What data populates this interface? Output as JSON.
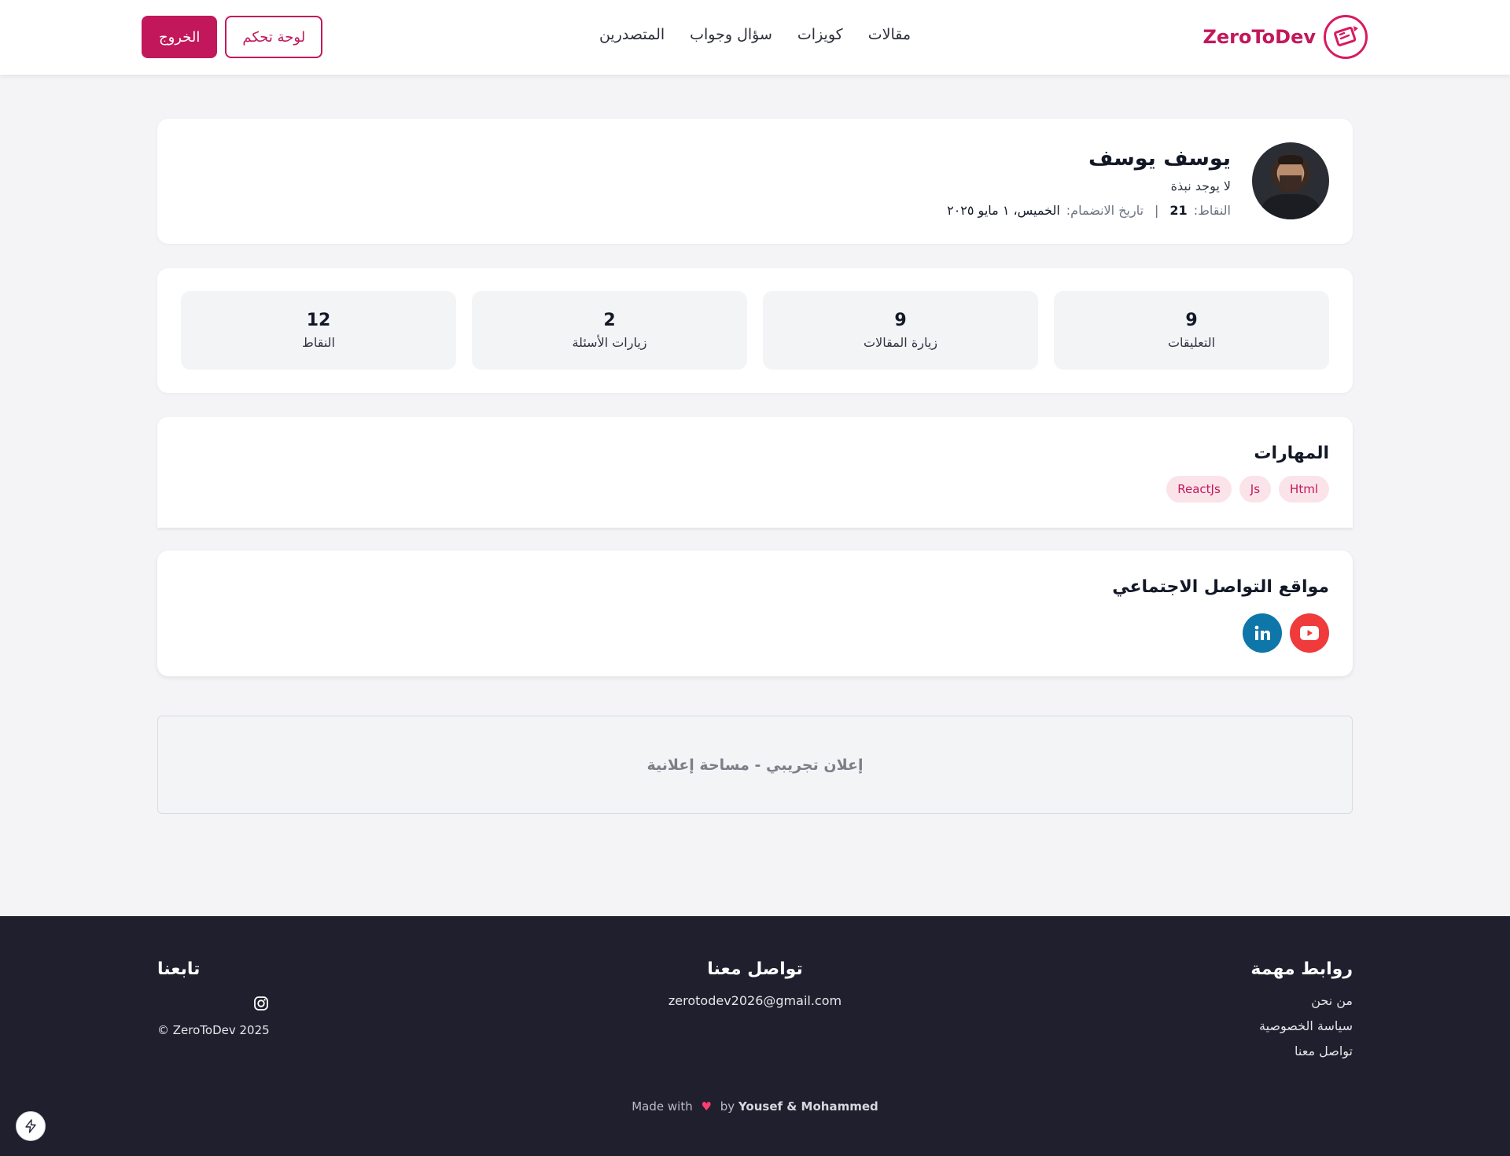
{
  "header": {
    "logo_text": "ZeroToDev",
    "nav": [
      {
        "label": "مقالات"
      },
      {
        "label": "كويزات"
      },
      {
        "label": "سؤال وجواب"
      },
      {
        "label": "المتصدرين"
      }
    ],
    "dashboard_label": "لوحة تحكم",
    "logout_label": "الخروج",
    "brand_color": "#c2185b"
  },
  "profile": {
    "name": "يوسف يوسف",
    "bio": "لا يوجد نبذة",
    "points_label": "النقاط:",
    "points_value": "21",
    "separator": "|",
    "join_label": "تاريخ الانضمام:",
    "join_value": "الخميس، ١ مايو ٢٠٢٥"
  },
  "stats": [
    {
      "value": "9",
      "label": "التعليقات"
    },
    {
      "value": "9",
      "label": "زيارة المقالات"
    },
    {
      "value": "2",
      "label": "زيارات الأسئلة"
    },
    {
      "value": "12",
      "label": "النقاط"
    }
  ],
  "skills": {
    "title": "المهارات",
    "items": [
      "Html",
      "Js",
      "ReactJs"
    ]
  },
  "social": {
    "title": "مواقع التواصل الاجتماعي",
    "icons": [
      "youtube-icon",
      "linkedin-icon"
    ]
  },
  "ad": {
    "text": "إعلان تجريبي - مساحة إعلانية"
  },
  "footer": {
    "links_title": "روابط مهمة",
    "links": [
      "من نحن",
      "سياسة الخصوصية",
      "تواصل معنا"
    ],
    "contact_title": "تواصل معنا",
    "email": "zerotodev2026@gmail.com",
    "follow_title": "تابعنا",
    "copyright": "© ZeroToDev 2025",
    "made_with_prefix": "Made with",
    "made_with_by": "by",
    "authors": "Yousef & Mohammed"
  }
}
